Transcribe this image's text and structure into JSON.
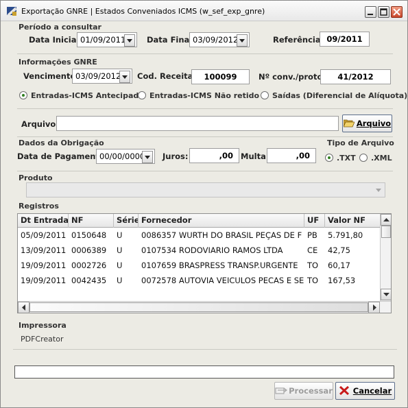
{
  "window": {
    "title": "Exportação GNRE | Estados Conveniados ICMS (w_sef_exp_gnre)"
  },
  "periodo": {
    "group_label": "Período a consultar",
    "data_inicial_label": "Data Inicial:",
    "data_inicial": "01/09/2011",
    "data_final_label": "Data Final:",
    "data_final": "03/09/2012",
    "referencia_label": "Referência:",
    "referencia": "09/2011"
  },
  "gnre": {
    "group_label": "Informações GNRE",
    "vencimento_label": "Vencimento:",
    "vencimento": "03/09/2012",
    "cod_receita_label": "Cod. Receita:",
    "cod_receita": "100099",
    "conv_label": "Nº conv./protoc:",
    "conv": "41/2012",
    "radios": [
      {
        "label": "Entradas-ICMS Antecipado",
        "selected": true
      },
      {
        "label": "Entradas-ICMS Não retido",
        "selected": false
      },
      {
        "label": "Saídas (Diferencial de Alíquota)",
        "selected": false
      }
    ]
  },
  "arquivo": {
    "label": "Arquivo:",
    "value": "",
    "button_label": "Arquivo"
  },
  "obrigacao": {
    "group_label": "Dados da Obrigação",
    "data_pagamento_label": "Data de Pagamento:",
    "data_pagamento": "00/00/0000",
    "juros_label": "Juros:",
    "juros": ",00",
    "multa_label": "Multa:",
    "multa": ",00"
  },
  "tipo_arquivo": {
    "group_label": "Tipo de Arquivo",
    "options": [
      {
        "label": ".TXT",
        "selected": true
      },
      {
        "label": ".XML",
        "selected": false
      }
    ]
  },
  "produto": {
    "label": "Produto",
    "value": ""
  },
  "registros": {
    "label": "Registros",
    "columns": [
      "Dt Entrada",
      "NF",
      "Série",
      "Fornecedor",
      "UF",
      "Valor NF"
    ],
    "rows": [
      [
        "05/09/2011",
        "0150648",
        "U",
        "0086357  WURTH DO BRASIL PEÇAS DE F",
        "PB",
        "5.791,80"
      ],
      [
        "13/09/2011",
        "0006389",
        "U",
        "0107534  RODOVIARIO RAMOS LTDA",
        "CE",
        "42,75"
      ],
      [
        "19/09/2011",
        "0002726",
        "U",
        "0107659  BRASPRESS TRANSP.URGENTE",
        "TO",
        "60,17"
      ],
      [
        "19/09/2011",
        "0042435",
        "U",
        "0072578  AUTOVIA VEICULOS PECAS E SE",
        "TO",
        "167,53"
      ]
    ]
  },
  "impressora": {
    "label": "Impressora",
    "value": "PDFCreator"
  },
  "status": {
    "text": ""
  },
  "actions": {
    "processar_label": "Processar",
    "cancelar_label": "Cancelar"
  },
  "colors": {
    "window_bg": "#ecebe4",
    "radio_selected": "#2f7f1e",
    "close_button": "#c8472b"
  }
}
